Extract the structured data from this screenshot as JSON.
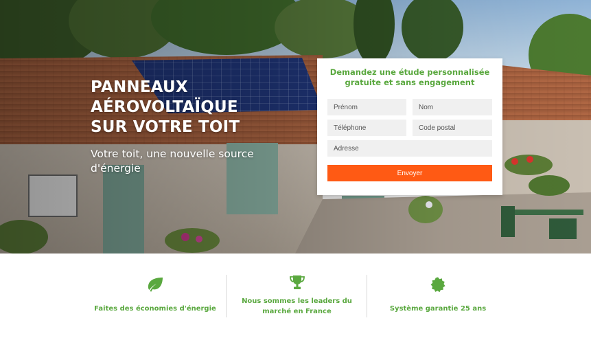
{
  "hero": {
    "title_lines": [
      "PANNEAUX",
      "AÉROVOLTAÏQUE",
      "SUR VOTRE TOIT"
    ],
    "subtitle": "Votre toit, une nouvelle source d'énergie"
  },
  "form": {
    "heading": "Demandez une étude personnalisée gratuite et sans engagement",
    "fields": {
      "prenom": {
        "placeholder": "Prénom",
        "value": ""
      },
      "nom": {
        "placeholder": "Nom",
        "value": ""
      },
      "telephone": {
        "placeholder": "Téléphone",
        "value": ""
      },
      "code_postal": {
        "placeholder": "Code postal",
        "value": ""
      },
      "adresse": {
        "placeholder": "Adresse",
        "value": ""
      }
    },
    "submit_label": "Envoyer"
  },
  "features": [
    {
      "icon": "leaf-icon",
      "label": "Faites des économies d'énergie"
    },
    {
      "icon": "trophy-icon",
      "label": "Nous sommes les leaders du marché en France"
    },
    {
      "icon": "badge-icon",
      "label": "Système garantie 25 ans"
    }
  ],
  "colors": {
    "accent_green": "#5aa83f",
    "button_orange": "#ff5a14",
    "input_bg": "#f0f0f0"
  }
}
